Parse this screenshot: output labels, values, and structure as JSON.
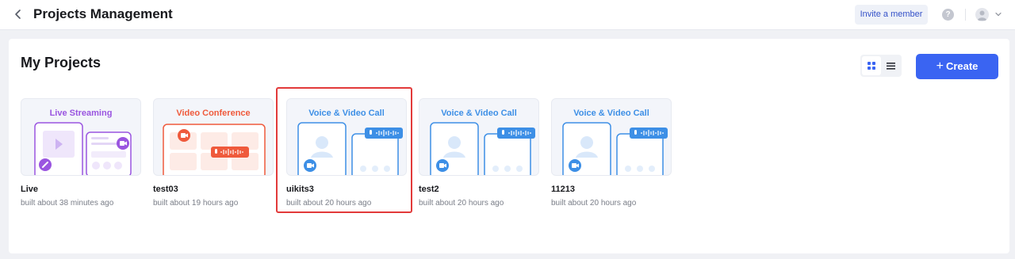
{
  "header": {
    "title": "Projects Management",
    "invite_label": "Invite a member",
    "help_label": "?",
    "back_icon": "chevron-left-icon",
    "avatar_icon": "user-avatar-icon"
  },
  "main": {
    "title": "My Projects",
    "create_label": "Create",
    "create_icon": "plus-icon",
    "view_mode": "grid",
    "accent_color": "#3a64f2",
    "projects": [
      {
        "thumb_title": "Live Streaming",
        "thumb_color": "#9a55e0",
        "name": "Live",
        "built": "built about 38 minutes ago"
      },
      {
        "thumb_title": "Video Conference",
        "thumb_color": "#ef5a3c",
        "name": "test03",
        "built": "built about 19 hours ago"
      },
      {
        "thumb_title": "Voice & Video Call",
        "thumb_color": "#3d8fe6",
        "name": "uikits3",
        "built": "built about 20 hours ago",
        "highlighted": true
      },
      {
        "thumb_title": "Voice & Video Call",
        "thumb_color": "#3d8fe6",
        "name": "test2",
        "built": "built about 20 hours ago"
      },
      {
        "thumb_title": "Voice & Video Call",
        "thumb_color": "#3d8fe6",
        "name": "11213",
        "built": "built about 20 hours ago"
      }
    ]
  }
}
